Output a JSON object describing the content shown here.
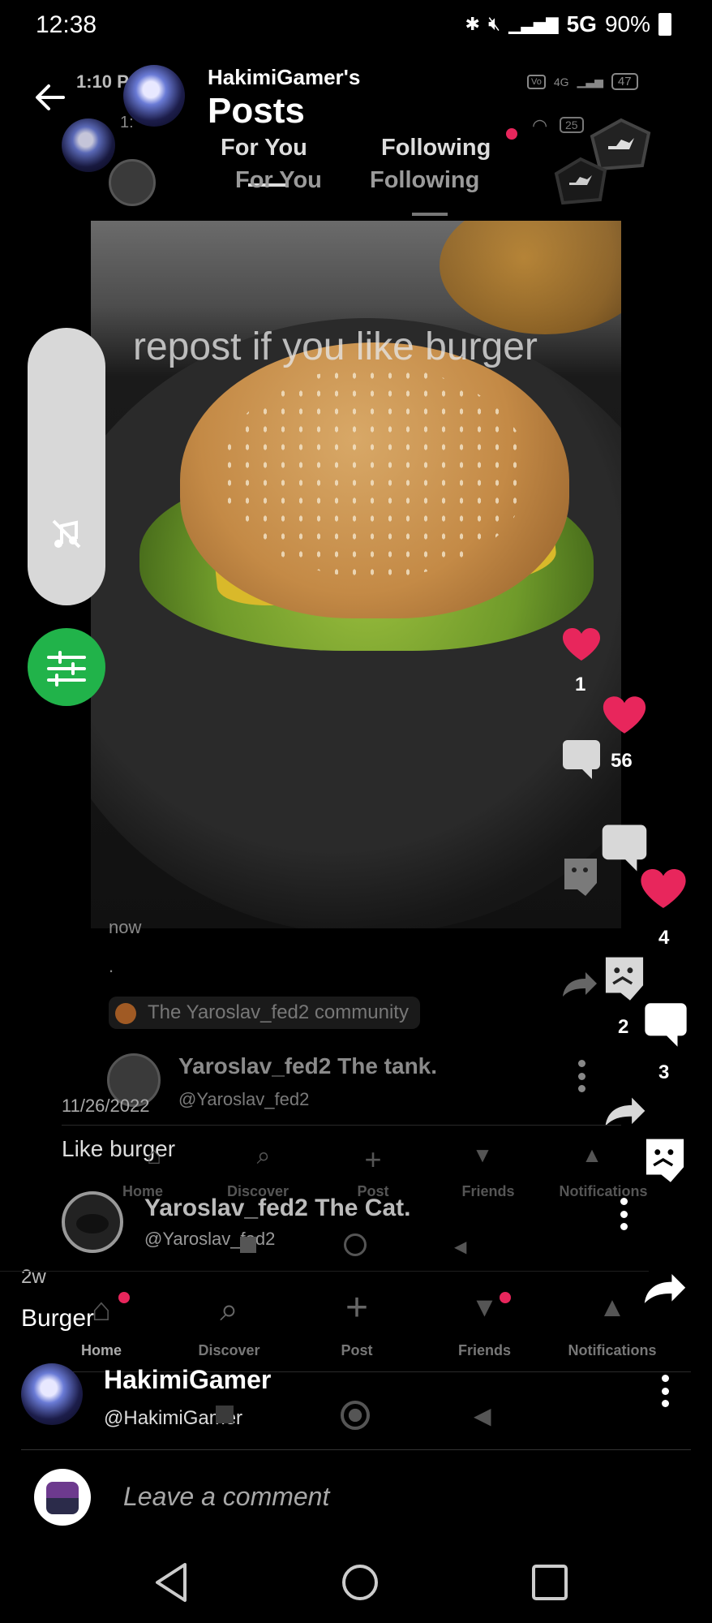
{
  "status_bar": {
    "time": "12:38",
    "network": "5G",
    "battery": "90%"
  },
  "ghost_status": {
    "time": "1:10 P",
    "time2": "1:",
    "signal_label": "4G",
    "battery": "47",
    "wifi_battery": "25"
  },
  "header": {
    "owner": "HakimiGamer's",
    "title": "Posts"
  },
  "tabs": {
    "for_you": "For You",
    "following": "Following"
  },
  "post": {
    "overlay_text": "repost if you like burger",
    "time": "now",
    "body": ".",
    "community": "The Yaroslav_fed2 community",
    "author_name": "Yaroslav_fed2 The tank.",
    "author_handle": "@Yaroslav_fed2",
    "date": "11/26/2022",
    "caption": "Like burger"
  },
  "ghost_post2": {
    "author_name": "Yaroslav_fed2 The Cat.",
    "author_handle": "@Yaroslav_fed2"
  },
  "ghost_nav": [
    "Home",
    "Discover",
    "Post",
    "Friends",
    "Notifications"
  ],
  "nav": [
    "Home",
    "Discover",
    "Post",
    "Friends",
    "Notifications"
  ],
  "actions": {
    "like_count_a": "1",
    "comment_count_a": "56",
    "like_count_b": "4",
    "comment_count_b": "2",
    "comment_count_c": "3"
  },
  "current_post": {
    "age": "2w",
    "caption": "Burger",
    "author_name": "HakimiGamer",
    "author_handle": "@HakimiGamer"
  },
  "comment_box": {
    "placeholder": "Leave a comment"
  },
  "colors": {
    "like": "#e8265c",
    "filter": "#21b34a",
    "badge": "#e8265c"
  }
}
